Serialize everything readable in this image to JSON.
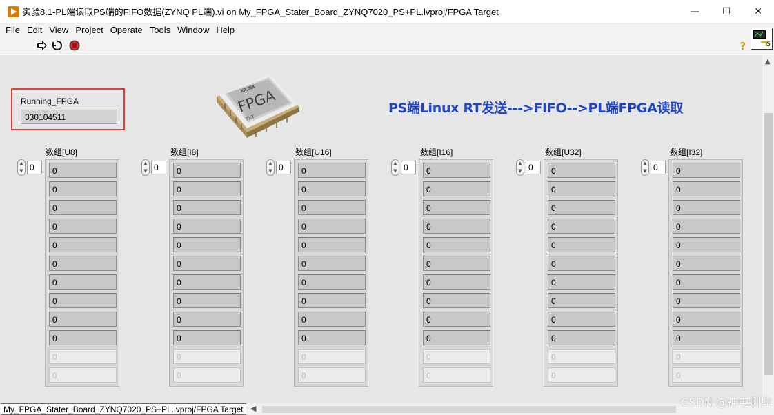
{
  "window": {
    "title": "实验8.1-PL端读取PS端的FIFO数据(ZYNQ PL端).vi on My_FPGA_Stater_Board_ZYNQ7020_PS+PL.lvproj/FPGA Target",
    "minimize": "—",
    "maximize": "☐",
    "close": "✕"
  },
  "menu": [
    "File",
    "Edit",
    "View",
    "Project",
    "Operate",
    "Tools",
    "Window",
    "Help"
  ],
  "toolbar": {
    "run_icon": "run-arrow-icon",
    "run_continuous_icon": "run-continuously-icon",
    "abort_icon": "abort-stop-icon",
    "help": "?",
    "vi_icon_number": "5"
  },
  "indicator": {
    "label": "Running_FPGA",
    "value": "330104511"
  },
  "chip": {
    "brand": "XILINX",
    "text": "FPGA",
    "sub": "TXT"
  },
  "banner": "PS端Linux RT发送--->FIFO-->PL端FPGA读取",
  "arrays": [
    {
      "label": "数组[U8]",
      "index": "0",
      "values": [
        "0",
        "0",
        "0",
        "0",
        "0",
        "0",
        "0",
        "0",
        "0",
        "0"
      ],
      "disabled": [
        "0",
        "0"
      ]
    },
    {
      "label": "数组[I8]",
      "index": "0",
      "values": [
        "0",
        "0",
        "0",
        "0",
        "0",
        "0",
        "0",
        "0",
        "0",
        "0"
      ],
      "disabled": [
        "0",
        "0"
      ]
    },
    {
      "label": "数组[U16]",
      "index": "0",
      "values": [
        "0",
        "0",
        "0",
        "0",
        "0",
        "0",
        "0",
        "0",
        "0",
        "0"
      ],
      "disabled": [
        "0",
        "0"
      ]
    },
    {
      "label": "数组[I16]",
      "index": "0",
      "values": [
        "0",
        "0",
        "0",
        "0",
        "0",
        "0",
        "0",
        "0",
        "0",
        "0"
      ],
      "disabled": [
        "0",
        "0"
      ]
    },
    {
      "label": "数组[U32]",
      "index": "0",
      "values": [
        "0",
        "0",
        "0",
        "0",
        "0",
        "0",
        "0",
        "0",
        "0",
        "0"
      ],
      "disabled": [
        "0",
        "0"
      ]
    },
    {
      "label": "数组[I32]",
      "index": "0",
      "values": [
        "0",
        "0",
        "0",
        "0",
        "0",
        "0",
        "0",
        "0",
        "0",
        "0"
      ],
      "disabled": [
        "0",
        "0"
      ]
    }
  ],
  "status": {
    "path": "My_FPGA_Stater_Board_ZYNQ7020_PS+PL.lvproj/FPGA Target"
  },
  "watermark": "CSDN @神电测控"
}
